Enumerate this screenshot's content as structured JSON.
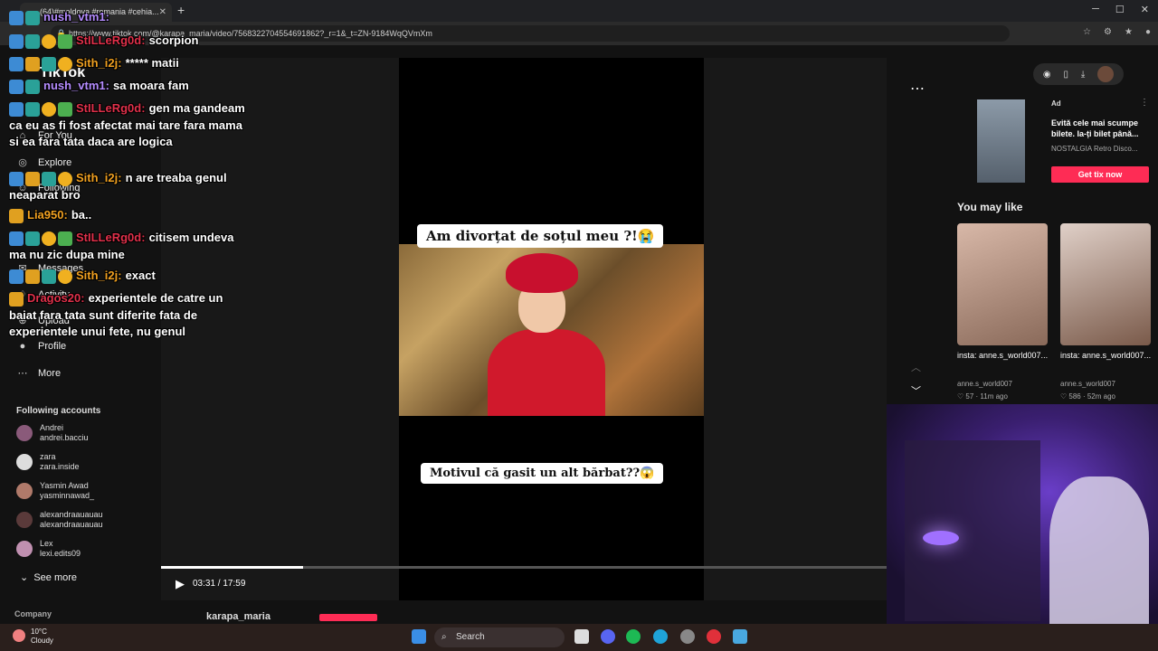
{
  "browser": {
    "tab_title": "(64)#moldova #romania #cehia...",
    "url": "https://www.tiktok.com/@karapa_maria/video/7568322704554691862?_r=1&_t=ZN-9184WqQVmXm"
  },
  "tiktok": {
    "logo": "TikTok",
    "nav": [
      {
        "label": "For You"
      },
      {
        "label": "Explore"
      },
      {
        "label": "Following"
      },
      {
        "label": "Messages"
      },
      {
        "label": "Activity"
      },
      {
        "label": "Upload"
      },
      {
        "label": "Profile"
      },
      {
        "label": "More"
      }
    ],
    "following_header": "Following accounts",
    "accounts": [
      {
        "name": "Andrei",
        "handle": "andrei.bacciu"
      },
      {
        "name": "zara",
        "handle": "zara.inside"
      },
      {
        "name": "Yasmin Awad",
        "handle": "yasminnawad_"
      },
      {
        "name": "alexandraauauau",
        "handle": "alexandraauauau"
      },
      {
        "name": "Lex",
        "handle": "lexi.edits09"
      }
    ],
    "see_more": "See more",
    "company": "Company"
  },
  "video": {
    "caption_top": "Am divorțat de soțul meu ?!😭",
    "caption_bottom": "Motivul că gasit un alt bărbat??😱",
    "time": "03:31 / 17:59",
    "progress": 0.196,
    "author": "karapa_maria"
  },
  "ad": {
    "label": "Ad",
    "text": "Evită cele mai scumpe bilete. Ia-ți bilet până...",
    "sub": "NOSTALGIA Retro Disco...",
    "cta": "Get tix now"
  },
  "recommend": {
    "heading": "You may like",
    "items": [
      {
        "title": "insta: anne.s_world007...",
        "handle": "anne.s_world007",
        "stats": "♡ 57 · 11m ago"
      },
      {
        "title": "insta: anne.s_world007...",
        "handle": "anne.s_world007",
        "stats": "♡ 586 · 52m ago"
      }
    ]
  },
  "chat": [
    {
      "user": "nush_vtm1:",
      "color": "#b58cff",
      "text": ""
    },
    {
      "user": "StILLeRg0d:",
      "color": "#e0304a",
      "text": "scorpion"
    },
    {
      "user": "Sith_i2j:",
      "color": "#f0a020",
      "text": "***** matii"
    },
    {
      "user": "nush_vtm1:",
      "color": "#b58cff",
      "text": "sa moara fam"
    },
    {
      "user": "StILLeRg0d:",
      "color": "#e0304a",
      "text": "gen ma gandeam ca eu as fi fost afectat mai tare fara mama si ea fara tata daca are logica"
    },
    {
      "user": "Sith_i2j:",
      "color": "#f0a020",
      "text": "n are treaba genul neaparat bro"
    },
    {
      "user": "Lia950:",
      "color": "#f0a020",
      "text": "ba.."
    },
    {
      "user": "StILLeRg0d:",
      "color": "#e0304a",
      "text": "citisem undeva ma nu zic dupa mine"
    },
    {
      "user": "Sith_i2j:",
      "color": "#f0a020",
      "text": "exact"
    },
    {
      "user": "Dragos20:",
      "color": "#e0304a",
      "text": "experientele de catre un baiat fara tata sunt diferite fata de experientele unui fete, nu genul"
    }
  ],
  "taskbar": {
    "temp": "10°C",
    "weather": "Cloudy",
    "search": "Search"
  }
}
